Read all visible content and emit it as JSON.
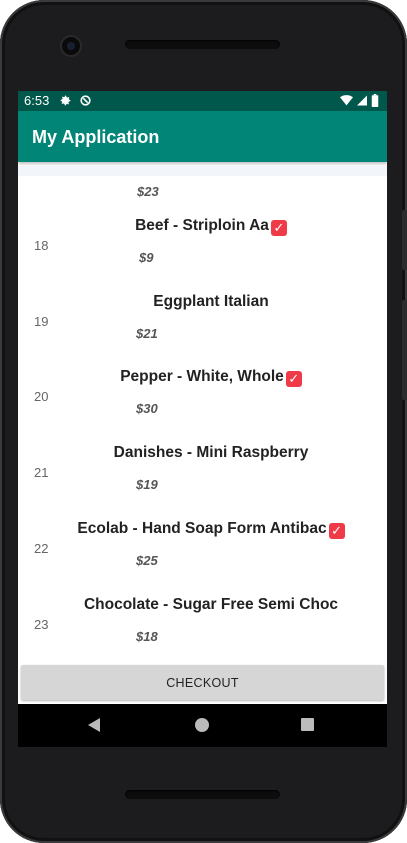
{
  "status_bar": {
    "time": "6:53"
  },
  "app_bar": {
    "title": "My Application"
  },
  "list": {
    "partial_top_price": "$23",
    "items": [
      {
        "num": "18",
        "name": "Beef - Striploin Aa",
        "price": "$9",
        "checked": true
      },
      {
        "num": "19",
        "name": "Eggplant Italian",
        "price": "$21",
        "checked": false
      },
      {
        "num": "20",
        "name": "Pepper - White, Whole",
        "price": "$30",
        "checked": true
      },
      {
        "num": "21",
        "name": "Danishes - Mini Raspberry",
        "price": "$19",
        "checked": false
      },
      {
        "num": "22",
        "name": "Ecolab - Hand Soap Form Antibac",
        "price": "$25",
        "checked": true
      },
      {
        "num": "23",
        "name": "Chocolate - Sugar Free Semi Choc",
        "price": "$18",
        "checked": false
      }
    ]
  },
  "checkout": {
    "label": "CHECKOUT"
  },
  "colors": {
    "status_bar": "#00574b",
    "app_bar": "#008577",
    "check_badge": "#ef3b47",
    "checkout_button": "#d6d6d6"
  },
  "icons": {
    "checked": "check-box-icon",
    "nav_back": "back-triangle-icon",
    "nav_home": "home-circle-icon",
    "nav_recent": "recents-square-icon"
  }
}
